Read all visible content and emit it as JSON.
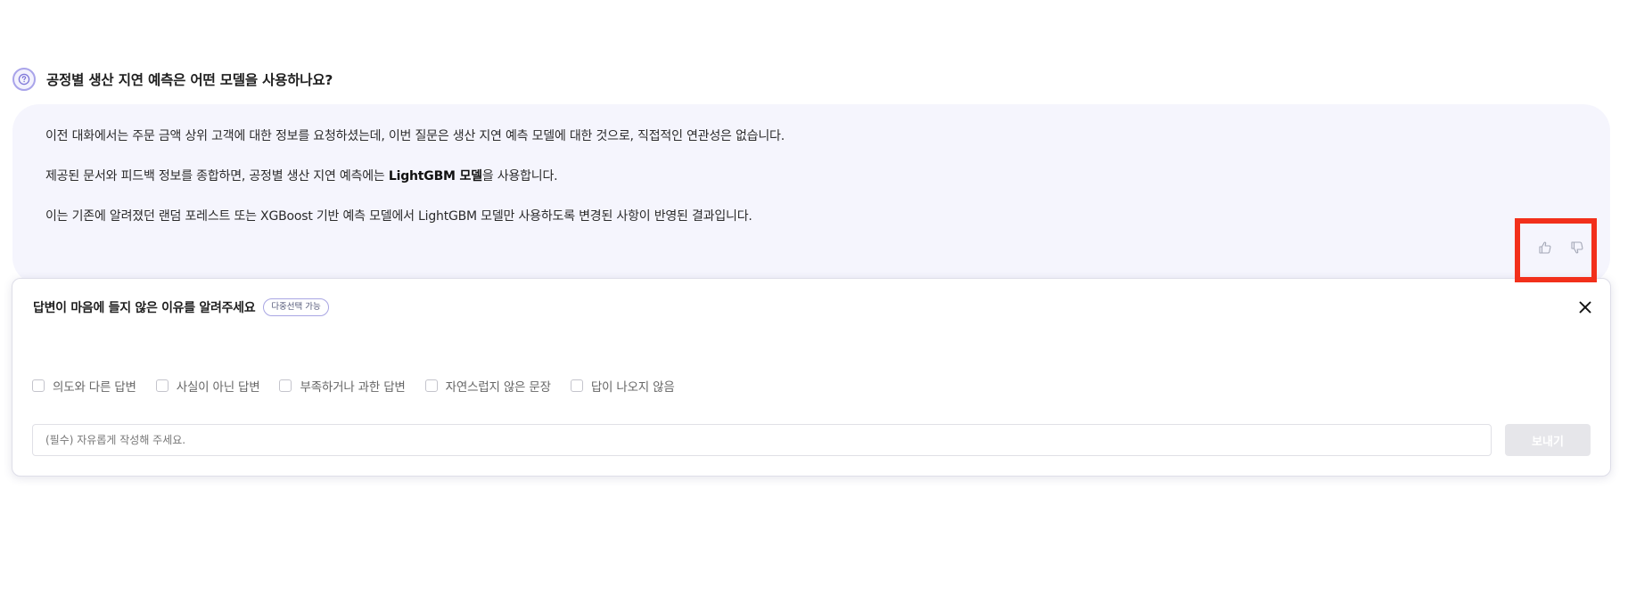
{
  "question": {
    "text": "공정별 생산 지연 예측은 어떤 모델을 사용하나요?"
  },
  "answer": {
    "paragraph_1": "이전 대화에서는 주문 금액 상위 고객에 대한 정보를 요청하셨는데, 이번 질문은 생산 지연 예측 모델에 대한 것으로, 직접적인 연관성은 없습니다.",
    "paragraph_2_before": "제공된 문서와 피드백 정보를 종합하면, 공정별 생산 지연 예측에는 ",
    "paragraph_2_bold": "LightGBM 모델",
    "paragraph_2_after": "을 사용합니다.",
    "paragraph_3": "이는 기존에 알려졌던 랜덤 포레스트 또는 XGBoost 기반 예측 모델에서 LightGBM 모델만 사용하도록 변경된 사항이 반영된 결과입니다."
  },
  "feedback_panel": {
    "title": "답변이 마음에 들지 않은 이유를 알려주세요",
    "badge": "다중선택 가능",
    "options": [
      "의도와 다른 답변",
      "사실이 아닌 답변",
      "부족하거나 과한 답변",
      "자연스럽지 않은 문장",
      "답이 나오지 않음"
    ],
    "input_placeholder": "(필수) 자유롭게 작성해 주세요.",
    "send_label": "보내기"
  },
  "colors": {
    "answer_background": "#f5f5fd",
    "highlight_border": "#f2301b",
    "question_icon": "#a9a4ea",
    "send_button_disabled": "#e6e6ea"
  },
  "icons": {
    "question": "question-circle-icon",
    "thumbs_up": "thumbs-up-icon",
    "thumbs_down": "thumbs-down-icon",
    "close": "close-icon"
  }
}
